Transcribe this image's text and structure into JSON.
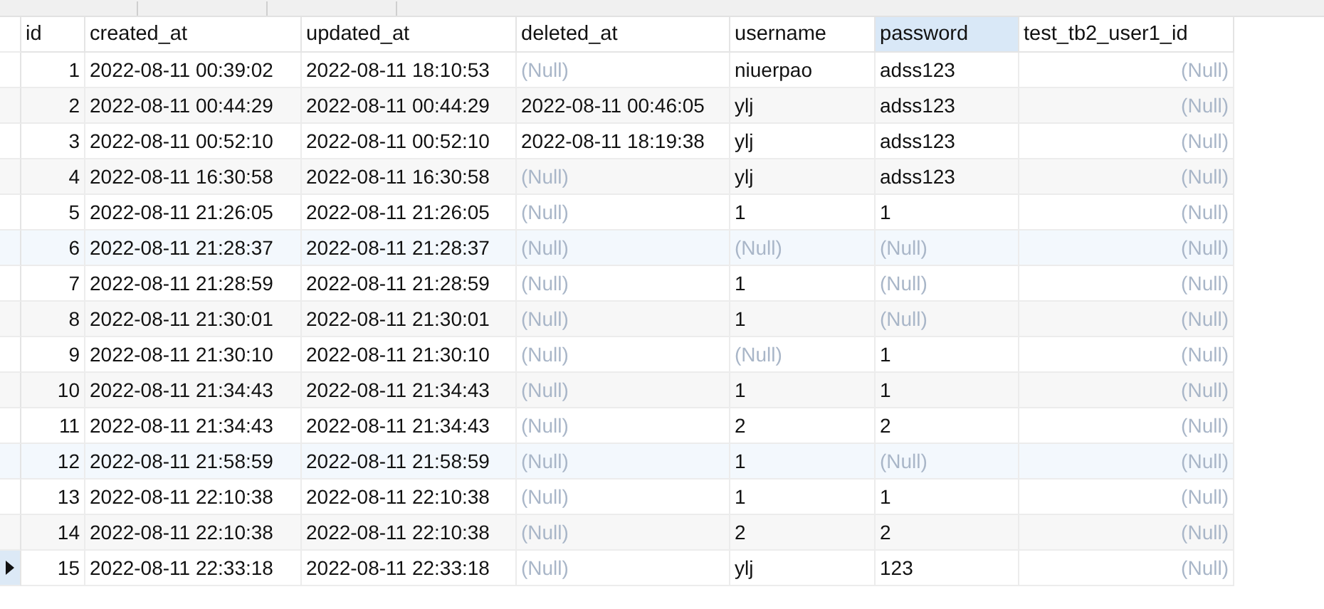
{
  "table": {
    "columns": [
      {
        "label": "id",
        "kind": "number",
        "selected": false
      },
      {
        "label": "created_at",
        "kind": "text",
        "selected": false
      },
      {
        "label": "updated_at",
        "kind": "text",
        "selected": false
      },
      {
        "label": "deleted_at",
        "kind": "text",
        "selected": false
      },
      {
        "label": "username",
        "kind": "text",
        "selected": false
      },
      {
        "label": "password",
        "kind": "text",
        "selected": true
      },
      {
        "label": "test_tb2_user1_id",
        "kind": "number",
        "selected": false
      }
    ],
    "rows": [
      {
        "current": false,
        "highlighted": false,
        "cells": [
          {
            "text": "1",
            "is_null": false
          },
          {
            "text": "2022-08-11 00:39:02",
            "is_null": false
          },
          {
            "text": "2022-08-11 18:10:53",
            "is_null": false
          },
          {
            "text": "(Null)",
            "is_null": true
          },
          {
            "text": "niuerpao",
            "is_null": false
          },
          {
            "text": "adss123",
            "is_null": false
          },
          {
            "text": "(Null)",
            "is_null": true
          }
        ]
      },
      {
        "current": false,
        "highlighted": false,
        "cells": [
          {
            "text": "2",
            "is_null": false
          },
          {
            "text": "2022-08-11 00:44:29",
            "is_null": false
          },
          {
            "text": "2022-08-11 00:44:29",
            "is_null": false
          },
          {
            "text": "2022-08-11 00:46:05",
            "is_null": false
          },
          {
            "text": "ylj",
            "is_null": false
          },
          {
            "text": "adss123",
            "is_null": false
          },
          {
            "text": "(Null)",
            "is_null": true
          }
        ]
      },
      {
        "current": false,
        "highlighted": false,
        "cells": [
          {
            "text": "3",
            "is_null": false
          },
          {
            "text": "2022-08-11 00:52:10",
            "is_null": false
          },
          {
            "text": "2022-08-11 00:52:10",
            "is_null": false
          },
          {
            "text": "2022-08-11 18:19:38",
            "is_null": false
          },
          {
            "text": "ylj",
            "is_null": false
          },
          {
            "text": "adss123",
            "is_null": false
          },
          {
            "text": "(Null)",
            "is_null": true
          }
        ]
      },
      {
        "current": false,
        "highlighted": false,
        "cells": [
          {
            "text": "4",
            "is_null": false
          },
          {
            "text": "2022-08-11 16:30:58",
            "is_null": false
          },
          {
            "text": "2022-08-11 16:30:58",
            "is_null": false
          },
          {
            "text": "(Null)",
            "is_null": true
          },
          {
            "text": "ylj",
            "is_null": false
          },
          {
            "text": "adss123",
            "is_null": false
          },
          {
            "text": "(Null)",
            "is_null": true
          }
        ]
      },
      {
        "current": false,
        "highlighted": false,
        "cells": [
          {
            "text": "5",
            "is_null": false
          },
          {
            "text": "2022-08-11 21:26:05",
            "is_null": false
          },
          {
            "text": "2022-08-11 21:26:05",
            "is_null": false
          },
          {
            "text": "(Null)",
            "is_null": true
          },
          {
            "text": "1",
            "is_null": false
          },
          {
            "text": "1",
            "is_null": false
          },
          {
            "text": "(Null)",
            "is_null": true
          }
        ]
      },
      {
        "current": false,
        "highlighted": true,
        "cells": [
          {
            "text": "6",
            "is_null": false
          },
          {
            "text": "2022-08-11 21:28:37",
            "is_null": false
          },
          {
            "text": "2022-08-11 21:28:37",
            "is_null": false
          },
          {
            "text": "(Null)",
            "is_null": true
          },
          {
            "text": "(Null)",
            "is_null": true
          },
          {
            "text": "(Null)",
            "is_null": true
          },
          {
            "text": "(Null)",
            "is_null": true
          }
        ]
      },
      {
        "current": false,
        "highlighted": false,
        "cells": [
          {
            "text": "7",
            "is_null": false
          },
          {
            "text": "2022-08-11 21:28:59",
            "is_null": false
          },
          {
            "text": "2022-08-11 21:28:59",
            "is_null": false
          },
          {
            "text": "(Null)",
            "is_null": true
          },
          {
            "text": "1",
            "is_null": false
          },
          {
            "text": "(Null)",
            "is_null": true
          },
          {
            "text": "(Null)",
            "is_null": true
          }
        ]
      },
      {
        "current": false,
        "highlighted": false,
        "cells": [
          {
            "text": "8",
            "is_null": false
          },
          {
            "text": "2022-08-11 21:30:01",
            "is_null": false
          },
          {
            "text": "2022-08-11 21:30:01",
            "is_null": false
          },
          {
            "text": "(Null)",
            "is_null": true
          },
          {
            "text": "1",
            "is_null": false
          },
          {
            "text": "(Null)",
            "is_null": true
          },
          {
            "text": "(Null)",
            "is_null": true
          }
        ]
      },
      {
        "current": false,
        "highlighted": false,
        "cells": [
          {
            "text": "9",
            "is_null": false
          },
          {
            "text": "2022-08-11 21:30:10",
            "is_null": false
          },
          {
            "text": "2022-08-11 21:30:10",
            "is_null": false
          },
          {
            "text": "(Null)",
            "is_null": true
          },
          {
            "text": "(Null)",
            "is_null": true
          },
          {
            "text": "1",
            "is_null": false
          },
          {
            "text": "(Null)",
            "is_null": true
          }
        ]
      },
      {
        "current": false,
        "highlighted": false,
        "cells": [
          {
            "text": "10",
            "is_null": false
          },
          {
            "text": "2022-08-11 21:34:43",
            "is_null": false
          },
          {
            "text": "2022-08-11 21:34:43",
            "is_null": false
          },
          {
            "text": "(Null)",
            "is_null": true
          },
          {
            "text": "1",
            "is_null": false
          },
          {
            "text": "1",
            "is_null": false
          },
          {
            "text": "(Null)",
            "is_null": true
          }
        ]
      },
      {
        "current": false,
        "highlighted": false,
        "cells": [
          {
            "text": "11",
            "is_null": false
          },
          {
            "text": "2022-08-11 21:34:43",
            "is_null": false
          },
          {
            "text": "2022-08-11 21:34:43",
            "is_null": false
          },
          {
            "text": "(Null)",
            "is_null": true
          },
          {
            "text": "2",
            "is_null": false
          },
          {
            "text": "2",
            "is_null": false
          },
          {
            "text": "(Null)",
            "is_null": true
          }
        ]
      },
      {
        "current": false,
        "highlighted": true,
        "cells": [
          {
            "text": "12",
            "is_null": false
          },
          {
            "text": "2022-08-11 21:58:59",
            "is_null": false
          },
          {
            "text": "2022-08-11 21:58:59",
            "is_null": false
          },
          {
            "text": "(Null)",
            "is_null": true
          },
          {
            "text": "1",
            "is_null": false
          },
          {
            "text": "(Null)",
            "is_null": true
          },
          {
            "text": "(Null)",
            "is_null": true
          }
        ]
      },
      {
        "current": false,
        "highlighted": false,
        "cells": [
          {
            "text": "13",
            "is_null": false
          },
          {
            "text": "2022-08-11 22:10:38",
            "is_null": false
          },
          {
            "text": "2022-08-11 22:10:38",
            "is_null": false
          },
          {
            "text": "(Null)",
            "is_null": true
          },
          {
            "text": "1",
            "is_null": false
          },
          {
            "text": "1",
            "is_null": false
          },
          {
            "text": "(Null)",
            "is_null": true
          }
        ]
      },
      {
        "current": false,
        "highlighted": false,
        "cells": [
          {
            "text": "14",
            "is_null": false
          },
          {
            "text": "2022-08-11 22:10:38",
            "is_null": false
          },
          {
            "text": "2022-08-11 22:10:38",
            "is_null": false
          },
          {
            "text": "(Null)",
            "is_null": true
          },
          {
            "text": "2",
            "is_null": false
          },
          {
            "text": "2",
            "is_null": false
          },
          {
            "text": "(Null)",
            "is_null": true
          }
        ]
      },
      {
        "current": true,
        "highlighted": false,
        "cells": [
          {
            "text": "15",
            "is_null": false
          },
          {
            "text": "2022-08-11 22:33:18",
            "is_null": false
          },
          {
            "text": "2022-08-11 22:33:18",
            "is_null": false
          },
          {
            "text": "(Null)",
            "is_null": true
          },
          {
            "text": "ylj",
            "is_null": false
          },
          {
            "text": "123",
            "is_null": false
          },
          {
            "text": "(Null)",
            "is_null": true
          }
        ]
      }
    ]
  }
}
